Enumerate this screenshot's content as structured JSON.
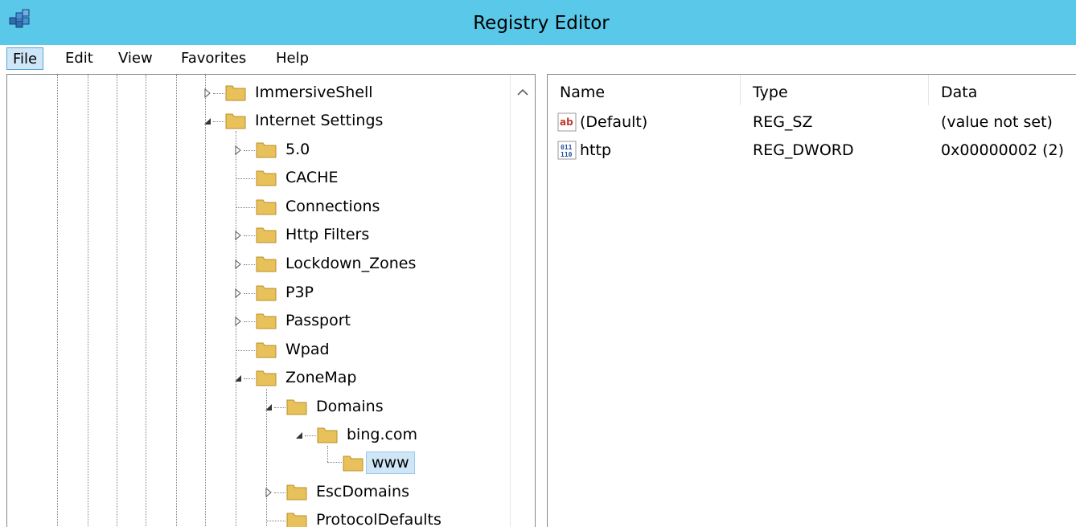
{
  "window": {
    "title": "Registry Editor",
    "app_icon": "regedit-icon"
  },
  "menu": {
    "file": "File",
    "edit": "Edit",
    "view": "View",
    "favorites": "Favorites",
    "help": "Help"
  },
  "tree": {
    "nodes": [
      {
        "label": "ImmersiveShell",
        "state": "collapsed"
      },
      {
        "label": "Internet Settings",
        "state": "expanded"
      },
      {
        "label": "5.0",
        "state": "collapsed"
      },
      {
        "label": "CACHE",
        "state": "leaf"
      },
      {
        "label": "Connections",
        "state": "leaf"
      },
      {
        "label": "Http Filters",
        "state": "collapsed"
      },
      {
        "label": "Lockdown_Zones",
        "state": "collapsed"
      },
      {
        "label": "P3P",
        "state": "collapsed"
      },
      {
        "label": "Passport",
        "state": "collapsed"
      },
      {
        "label": "Wpad",
        "state": "leaf"
      },
      {
        "label": "ZoneMap",
        "state": "expanded"
      },
      {
        "label": "Domains",
        "state": "expanded"
      },
      {
        "label": "bing.com",
        "state": "expanded"
      },
      {
        "label": "www",
        "state": "selected"
      },
      {
        "label": "EscDomains",
        "state": "collapsed"
      },
      {
        "label": "ProtocolDefaults",
        "state": "leaf"
      }
    ]
  },
  "values": {
    "columns": [
      "Name",
      "Type",
      "Data"
    ],
    "rows": [
      {
        "name": "(Default)",
        "type": "REG_SZ",
        "data": "(value not set)",
        "icon": "string-value-icon"
      },
      {
        "name": "http",
        "type": "REG_DWORD",
        "data": "0x00000002 (2)",
        "icon": "binary-value-icon"
      }
    ]
  },
  "colors": {
    "titlebar": "#5ac8e8",
    "selection": "#cfe6f7",
    "folder": "#e8c15a"
  }
}
